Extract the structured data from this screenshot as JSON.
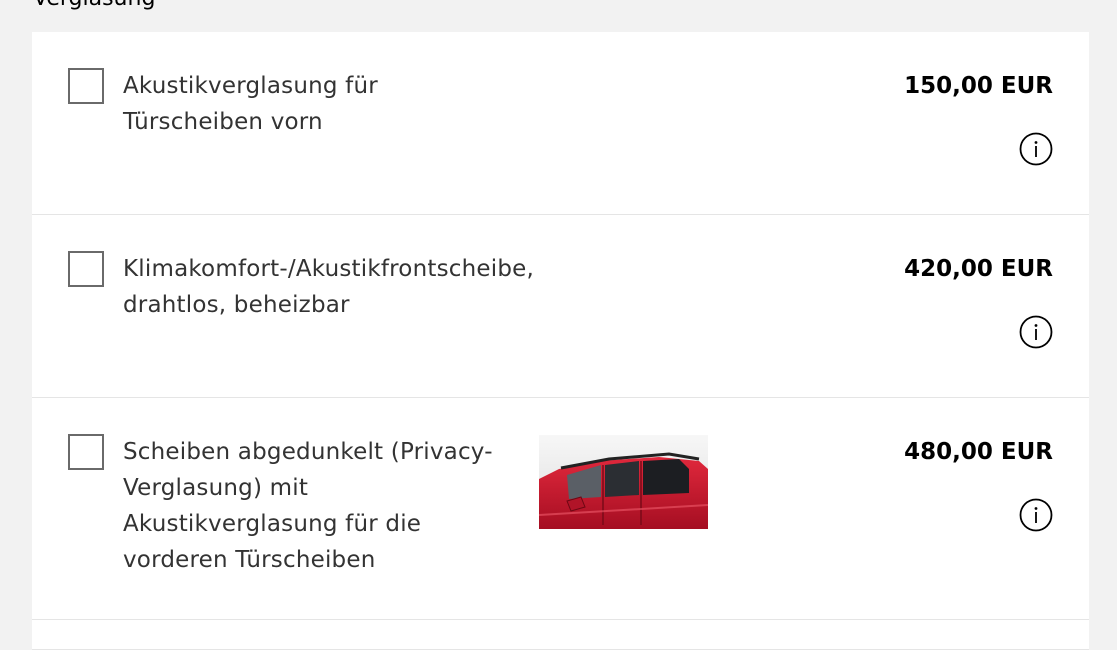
{
  "section": {
    "title": "Verglasung"
  },
  "options": [
    {
      "label_lines": [
        "Akustikverglasung für",
        "Türscheiben vorn"
      ],
      "price": "150,00 EUR",
      "checked": false,
      "info_icon": "info-circle-icon"
    },
    {
      "label_lines": [
        "Klimakomfort-/Akustikfrontscheibe,",
        "drahtlos, beheizbar"
      ],
      "price": "420,00 EUR",
      "checked": false,
      "info_icon": "info-circle-icon"
    },
    {
      "label_lines": [
        "Scheiben abgedunkelt (Privacy-",
        "Verglasung) mit",
        "Akustikverglasung für die",
        "vorderen Türscheiben"
      ],
      "price": "480,00 EUR",
      "checked": false,
      "info_icon": "info-circle-icon",
      "thumbnail": "red-car-tinted-windows"
    }
  ],
  "colors": {
    "page_background": "#f2f2f2",
    "card_background": "#ffffff",
    "text": "#333333",
    "price": "#000000",
    "car_red": "#c8102e"
  }
}
